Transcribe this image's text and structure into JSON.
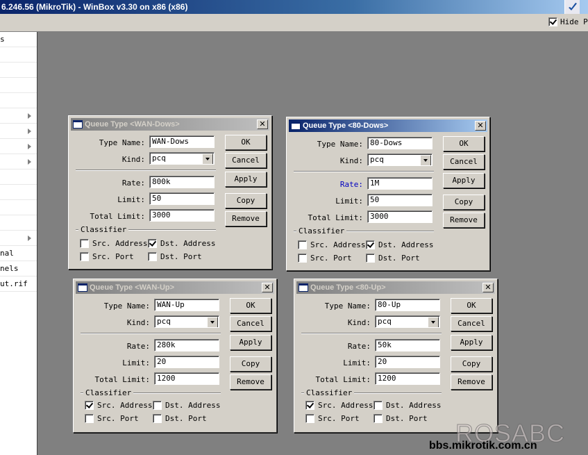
{
  "app": {
    "title": "6.246.56 (MikroTik) - WinBox v3.30 on x86 (x86)"
  },
  "toolbar": {
    "hide_passwords_label": "Hide Pa",
    "hide_passwords_checked": true
  },
  "sidebar": {
    "items": [
      {
        "label": "s",
        "arrow": false
      },
      {
        "label": "",
        "arrow": false
      },
      {
        "label": "",
        "arrow": false
      },
      {
        "label": "",
        "arrow": false
      },
      {
        "label": "",
        "arrow": false
      },
      {
        "label": "",
        "arrow": true
      },
      {
        "label": "",
        "arrow": true
      },
      {
        "label": "",
        "arrow": true
      },
      {
        "label": "",
        "arrow": true
      },
      {
        "label": "",
        "arrow": false
      },
      {
        "label": "",
        "arrow": false
      },
      {
        "label": "",
        "arrow": false
      },
      {
        "label": "",
        "arrow": false
      },
      {
        "label": "",
        "arrow": true
      },
      {
        "label": "nal",
        "arrow": false
      },
      {
        "label": "nels",
        "arrow": false
      },
      {
        "label": "ut.rif",
        "arrow": false
      }
    ]
  },
  "labels": {
    "type_name": "Type Name:",
    "kind": "Kind:",
    "rate": "Rate:",
    "limit": "Limit:",
    "total_limit": "Total Limit:",
    "classifier": "Classifier",
    "src_address": "Src. Address",
    "dst_address": "Dst. Address",
    "src_port": "Src. Port",
    "dst_port": "Dst. Port"
  },
  "buttons": {
    "ok": "OK",
    "cancel": "Cancel",
    "apply": "Apply",
    "copy": "Copy",
    "remove": "Remove"
  },
  "dialogs": [
    {
      "title": "Queue Type <WAN-Dows>",
      "type_name": "WAN-Dows",
      "kind": "pcq",
      "rate": "800k",
      "limit": "50",
      "total_limit": "3000",
      "src_address": false,
      "dst_address": true,
      "src_port": false,
      "dst_port": false,
      "active": false
    },
    {
      "title": "Queue Type <80-Dows>",
      "type_name": "80-Dows",
      "kind": "pcq",
      "rate": "1M",
      "limit": "50",
      "total_limit": "3000",
      "src_address": false,
      "dst_address": true,
      "src_port": false,
      "dst_port": false,
      "active": true
    },
    {
      "title": "Queue Type <WAN-Up>",
      "type_name": "WAN-Up",
      "kind": "pcq",
      "rate": "280k",
      "limit": "20",
      "total_limit": "1200",
      "src_address": true,
      "dst_address": false,
      "src_port": false,
      "dst_port": false,
      "active": false
    },
    {
      "title": "Queue Type <80-Up>",
      "type_name": "80-Up",
      "kind": "pcq",
      "rate": "50k",
      "limit": "20",
      "total_limit": "1200",
      "src_address": true,
      "dst_address": false,
      "src_port": false,
      "dst_port": false,
      "active": false
    }
  ],
  "watermark": {
    "logo": "ROSABC",
    "site": "bbs.mikrotik.com.cn"
  }
}
